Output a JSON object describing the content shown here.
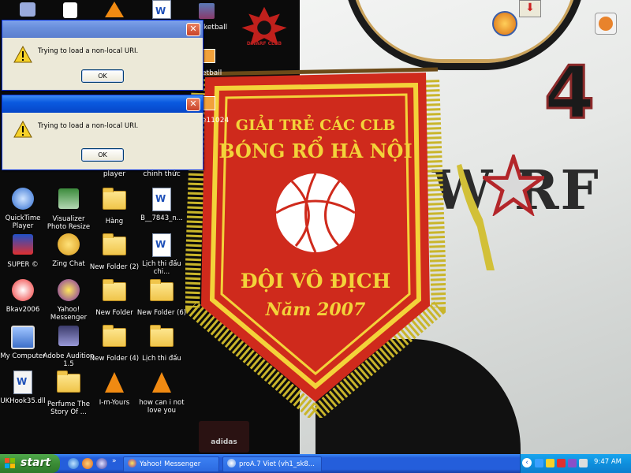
{
  "dialogs": [
    {
      "message": "Trying to load a non-local URI.",
      "ok_label": "OK",
      "close_glyph": "✕"
    },
    {
      "message": "Trying to load a non-local URI.",
      "ok_label": "OK",
      "close_glyph": "✕"
    }
  ],
  "wallpaper": {
    "pennant_line1": "GIẢI TRẺ CÁC CLB",
    "pennant_line2": "BÓNG RỔ HÀ NỘI",
    "pennant_line3": "ĐỘI VÔ ĐỊCH",
    "pennant_line4": "Năm 2007",
    "jersey_number": "4",
    "jersey_word": "W RF",
    "logo_text": "DWARF CLUB",
    "adidas_text": "adidas",
    "colors": {
      "pennant_red": "#cf2a1c",
      "pennant_gold": "#f3d33a",
      "jersey": "#e8eae8"
    }
  },
  "desktop_icons": {
    "top_row_partial": [
      "ketball",
      "etball",
      "e11024"
    ],
    "partial_labels": [
      "player",
      "chinh thức"
    ],
    "items": [
      {
        "name": "quicktime-player",
        "label": "QuickTime Player",
        "icon": "quicktime-icon"
      },
      {
        "name": "visualizer-photo-resize",
        "label": "Visualizer Photo Resize",
        "icon": "photo-resize-icon"
      },
      {
        "name": "hang",
        "label": "Hàng",
        "icon": "folder-icon"
      },
      {
        "name": "b-7843",
        "label": "B__7843_n...",
        "icon": "word-doc-icon"
      },
      {
        "name": "super",
        "label": "SUPER ©",
        "icon": "super-icon"
      },
      {
        "name": "zing-chat",
        "label": "Zing Chat",
        "icon": "zing-chat-icon"
      },
      {
        "name": "new-folder-2",
        "label": "New Folder (2)",
        "icon": "folder-icon"
      },
      {
        "name": "lich-thi-dau-chi",
        "label": "Lịch thi đấu chi...",
        "icon": "word-doc-icon"
      },
      {
        "name": "bkav2006",
        "label": "Bkav2006",
        "icon": "bkav-icon"
      },
      {
        "name": "yahoo-messenger",
        "label": "Yahoo! Messenger",
        "icon": "yahoo-icon"
      },
      {
        "name": "new-folder",
        "label": "New Folder",
        "icon": "folder-icon"
      },
      {
        "name": "new-folder-6",
        "label": "New Folder (6)",
        "icon": "folder-icon"
      },
      {
        "name": "my-computer",
        "label": "My Computer",
        "icon": "computer-icon"
      },
      {
        "name": "adobe-audition",
        "label": "Adobe Audition 1.5",
        "icon": "audition-icon"
      },
      {
        "name": "new-folder-4",
        "label": "New Folder (4)",
        "icon": "folder-icon"
      },
      {
        "name": "lich-thi-dau",
        "label": "Lịch thi đấu",
        "icon": "folder-icon"
      },
      {
        "name": "ukhook35",
        "label": "UKHook35.dll",
        "icon": "dll-icon"
      },
      {
        "name": "perfume",
        "label": "Perfume The Story Of ...",
        "icon": "folder-icon"
      },
      {
        "name": "i-m-yours",
        "label": "I-m-Yours",
        "icon": "vlc-icon"
      },
      {
        "name": "how-can-i-not-love-you",
        "label": "how can i not love you",
        "icon": "vlc-icon"
      }
    ]
  },
  "taskbar": {
    "start_label": "start",
    "tasks": [
      {
        "label": "Yahoo! Messenger",
        "icon": "yahoo-icon"
      },
      {
        "label": "proA.7 Viet (vh1_sk8...",
        "icon": "browser-icon"
      }
    ],
    "clock": "9:47 AM"
  }
}
